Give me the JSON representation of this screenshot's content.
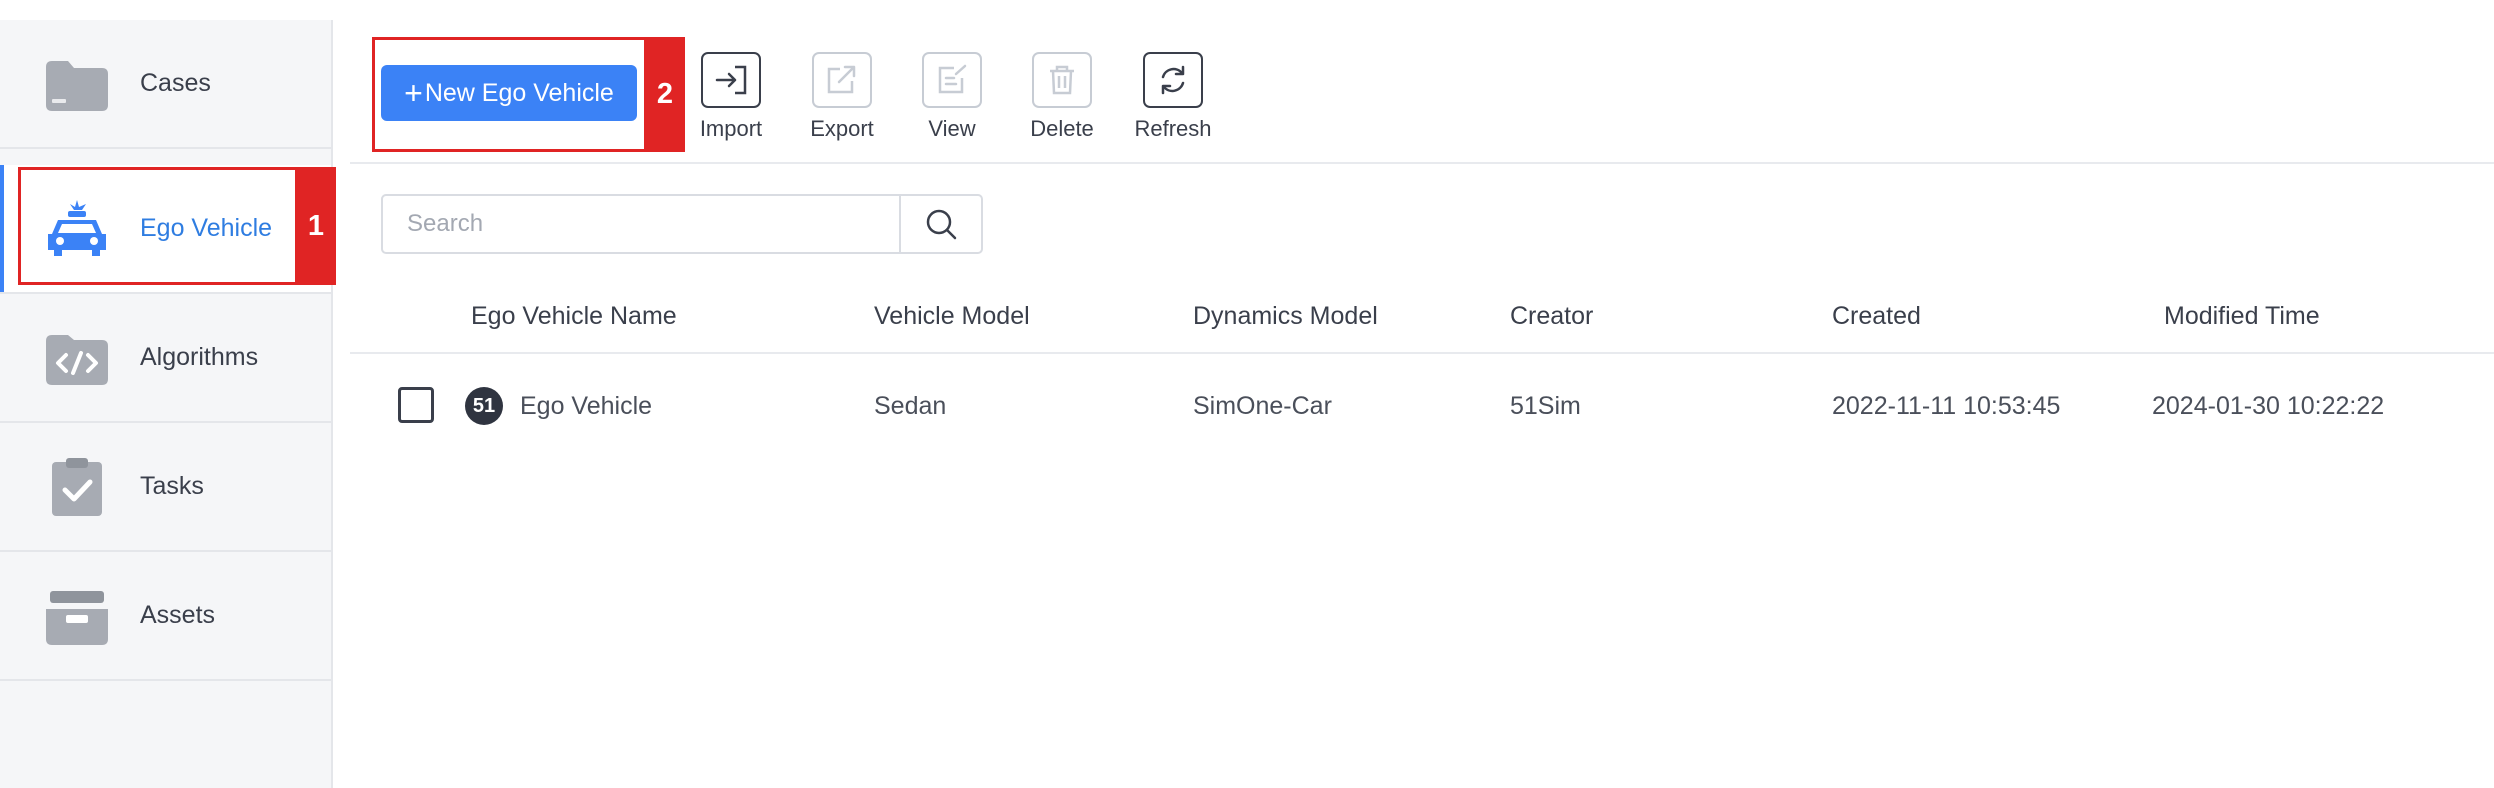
{
  "sidebar": {
    "items": [
      {
        "label": "Cases",
        "icon": "folder-icon"
      },
      {
        "label": "Ego Vehicle",
        "icon": "car-icon",
        "active": true
      },
      {
        "label": "Algorithms",
        "icon": "code-icon"
      },
      {
        "label": "Tasks",
        "icon": "clipboard-check-icon"
      },
      {
        "label": "Assets",
        "icon": "archive-box-icon"
      }
    ]
  },
  "annotations": {
    "step1": "1",
    "step2": "2"
  },
  "toolbar": {
    "new_label": "New Ego Vehicle",
    "new_plus": "+",
    "import_label": "Import",
    "export_label": "Export",
    "view_label": "View",
    "delete_label": "Delete",
    "refresh_label": "Refresh"
  },
  "search": {
    "placeholder": "Search",
    "value": ""
  },
  "table": {
    "headers": [
      "Ego Vehicle Name",
      "Vehicle Model",
      "Dynamics Model",
      "Creator",
      "Created",
      "Modified Time"
    ],
    "rows": [
      {
        "badge": "51",
        "name": "Ego Vehicle",
        "vehicle_model": "Sedan",
        "dynamics_model": "SimOne-Car",
        "creator": "51Sim",
        "created": "2022-11-11 10:53:45",
        "modified": "2024-01-30 10:22:22"
      }
    ]
  },
  "colors": {
    "primary": "#3b82f6",
    "active_text": "#2f7de1",
    "annotation": "#e02424",
    "icon_gray": "#a7abb3"
  }
}
